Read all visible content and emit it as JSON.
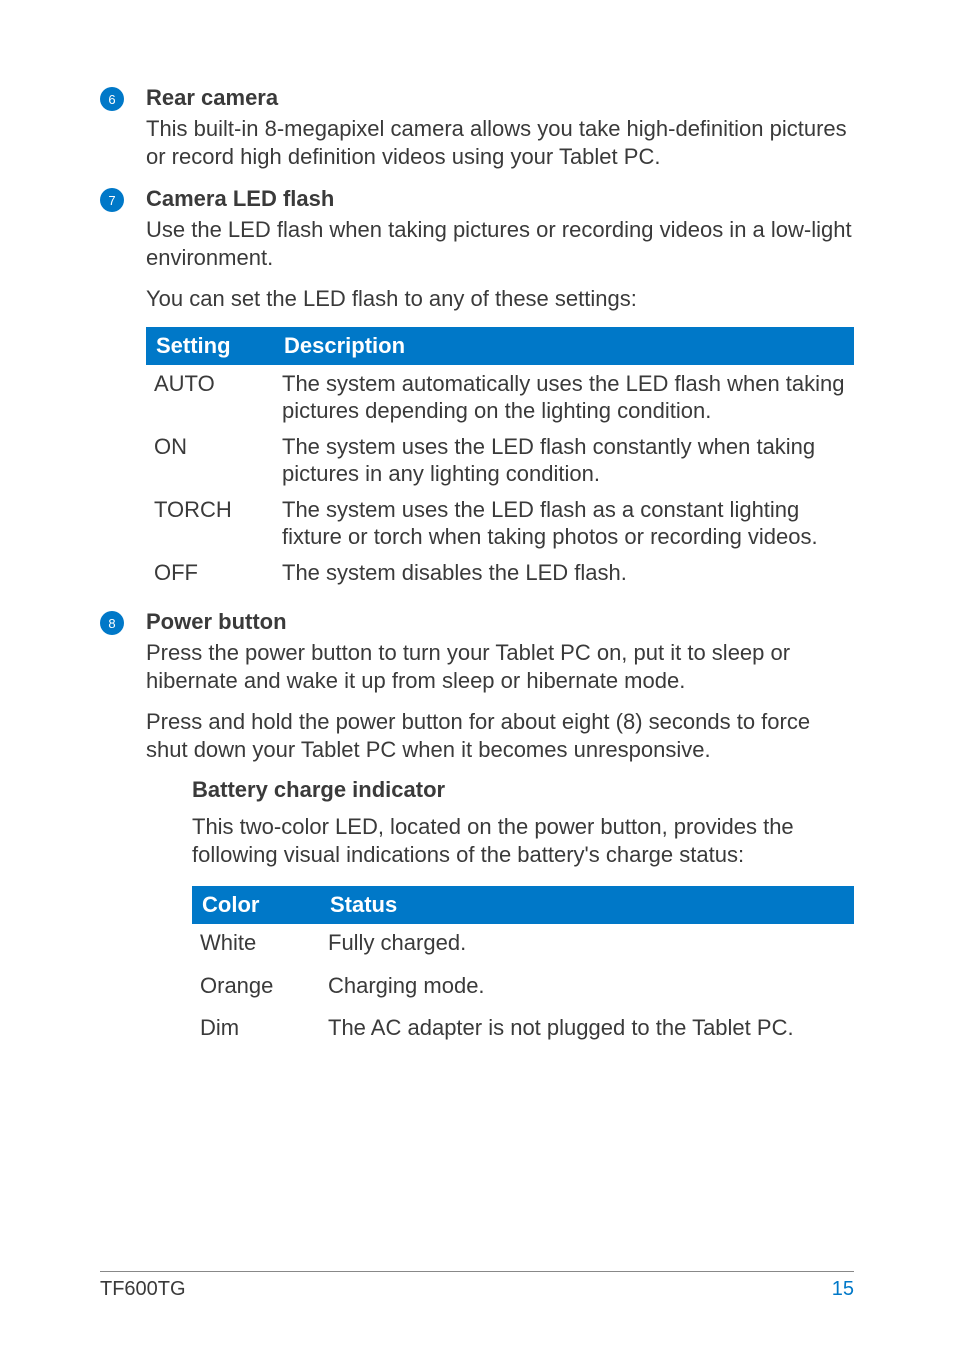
{
  "items": [
    {
      "num": "6",
      "title": "Rear camera",
      "paragraphs": [
        "This built-in 8-megapixel camera allows you take high-definition pictures or record high definition videos using your Tablet PC."
      ]
    },
    {
      "num": "7",
      "title": "Camera LED flash",
      "paragraphs": [
        "Use the LED flash when taking pictures or recording videos in a low-light environment.",
        "You can set the LED flash to any of these settings:"
      ],
      "table": {
        "headers": [
          "Setting",
          "Description"
        ],
        "rows": [
          [
            "AUTO",
            "The system automatically uses the LED flash when taking pictures depending on the lighting condition."
          ],
          [
            "ON",
            "The system uses the LED flash constantly when taking pictures in any lighting condition."
          ],
          [
            "TORCH",
            "The system uses the LED flash as a constant lighting fixture or torch when taking photos or recording videos."
          ],
          [
            "OFF",
            "The system disables the LED flash."
          ]
        ]
      }
    },
    {
      "num": "8",
      "title": "Power button",
      "paragraphs": [
        "Press the power button to turn your Tablet PC on, put it to sleep or hibernate and wake it up from sleep or hibernate mode.",
        "Press and hold the power button for about eight (8) seconds to force shut down your Tablet PC when it becomes unresponsive."
      ],
      "subsection": {
        "title": "Battery charge indicator",
        "text": "This two-color LED, located on the power button, provides the following visual indications of the battery's charge status:",
        "table": {
          "headers": [
            "Color",
            "Status"
          ],
          "rows": [
            [
              "White",
              "Fully charged."
            ],
            [
              "Orange",
              "Charging mode."
            ],
            [
              "Dim",
              "The AC adapter is not plugged to the Tablet PC."
            ]
          ]
        }
      }
    }
  ],
  "footer": {
    "model": "TF600TG",
    "page": "15"
  }
}
